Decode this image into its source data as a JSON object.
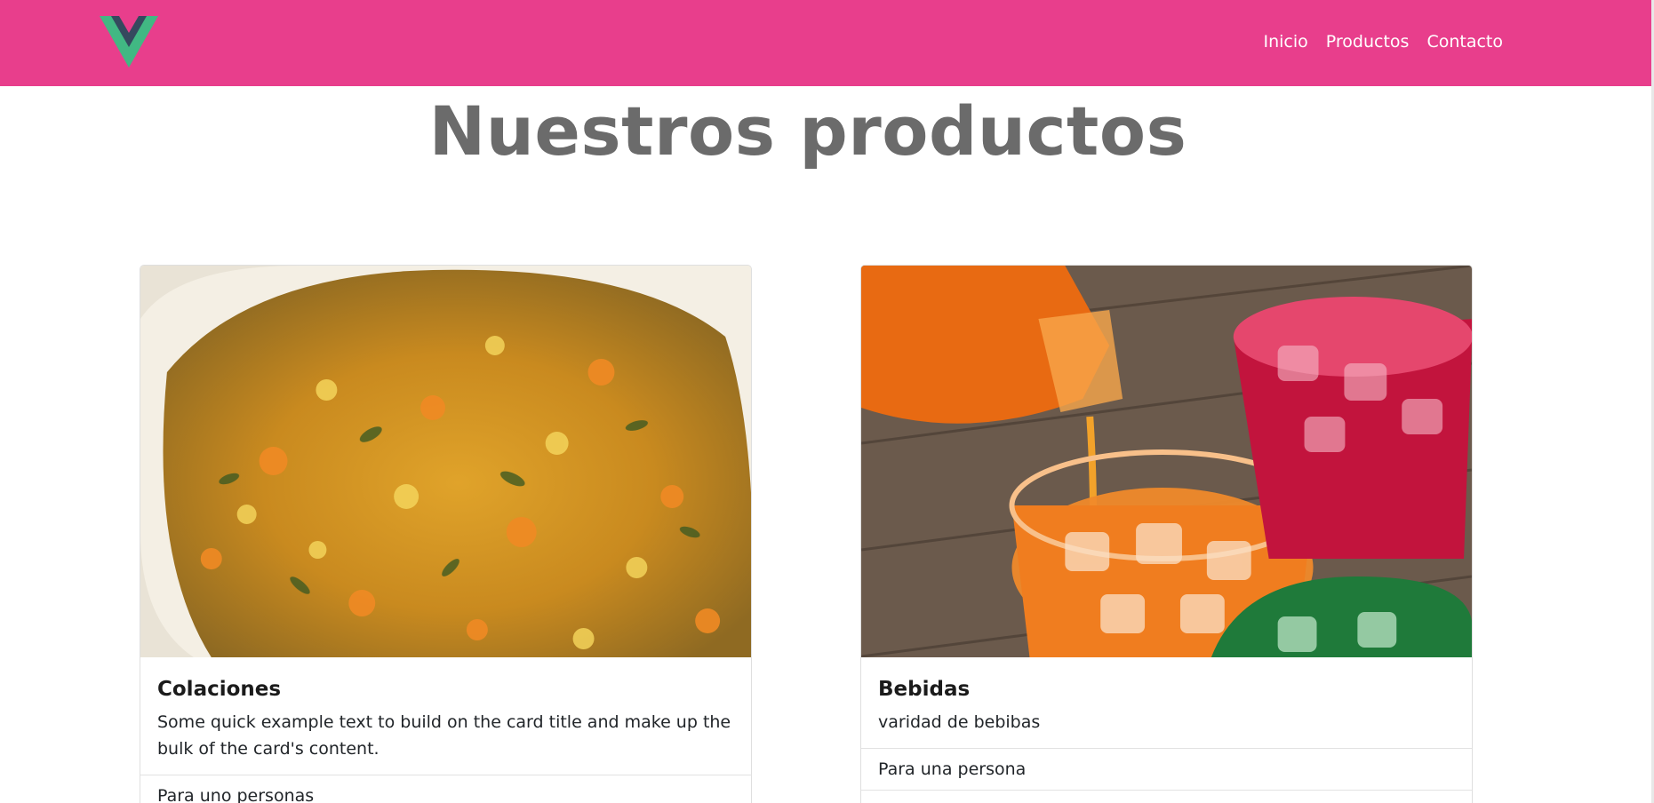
{
  "nav": {
    "logo": "vue-logo",
    "links": [
      "Inicio",
      "Productos",
      "Contacto"
    ]
  },
  "main": {
    "title": "Nuestros productos",
    "cards": [
      {
        "title": "Colaciones",
        "text": "Some quick example text to build on the card title and make up the bulk of the card's content.",
        "list": [
          "Para uno personas"
        ]
      },
      {
        "title": "Bebidas",
        "text": "varidad de bebibas",
        "list": [
          "Para una persona"
        ]
      }
    ]
  },
  "colors": {
    "navbar": "#e83e8c",
    "title": "#6b6b6b",
    "logo_green": "#41b883",
    "logo_dark": "#35495e"
  }
}
